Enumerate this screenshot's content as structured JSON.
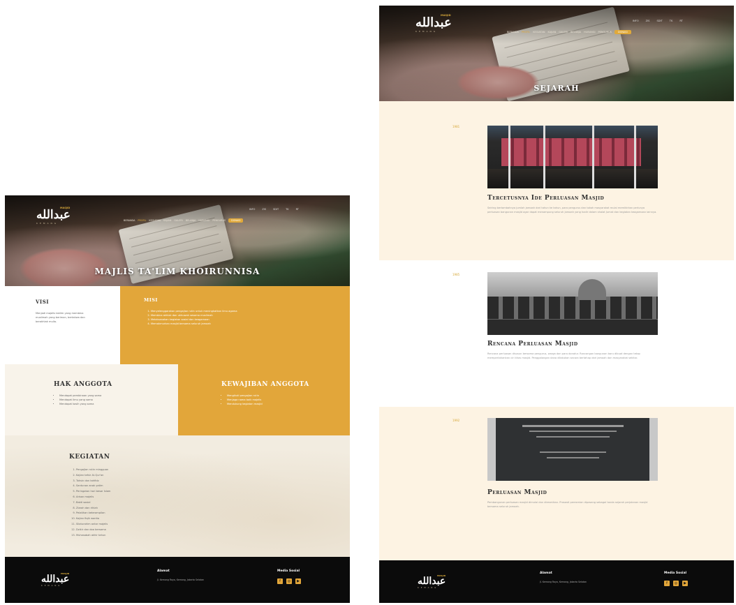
{
  "site": {
    "logo_arabic": "عبدالله",
    "logo_tag": "MASJID",
    "logo_sub": "KEMANG"
  },
  "top_nav": [
    "INFO",
    "ZIS",
    "SDIT",
    "TK",
    "RT"
  ],
  "main_nav": [
    "BERANDA",
    "PROFIL",
    "KEGIATAN",
    "KAJIAN",
    "GALERI",
    "BELANJA",
    "HUBUNGI",
    "PENGURUS",
    "DONASI"
  ],
  "left_page": {
    "hero_title": "MAJLIS TA'LIM KHOIRUNNISA",
    "visi": {
      "title": "VISI",
      "text": "Menjadi majelis taklim yang membina muslimah yang beriman, bertakwa dan berakhlak mulia."
    },
    "misi": {
      "title": "MISI",
      "items": [
        "Menyelenggarakan pengajian rutin untuk meningkatkan ilmu agama",
        "Membina akhlak dan ukhuwah sesama muslimah",
        "Melaksanakan kegiatan sosial dan keagamaan",
        "Memakmurkan masjid bersama seluruh jamaah"
      ]
    },
    "hak": {
      "title": "HAK ANGGOTA",
      "items": [
        "Mendapat pembinaan yang sama",
        "Mendapat ilmu yang sama",
        "Mendapat kasih yang sama"
      ]
    },
    "kewajiban": {
      "title": "KEWAJIBAN ANGGOTA",
      "items": [
        "Mengikuti pengajian rutin",
        "Menjaga nama baik majelis",
        "Mendukung kegiatan masjid"
      ]
    },
    "kegiatan": {
      "title": "KEGIATAN",
      "items": [
        "Pengajian rutin mingguan",
        "Kajian tafsir Al-Qur'an",
        "Tahsin dan tahfidz",
        "Santunan anak yatim",
        "Peringatan hari besar Islam",
        "Arisan majelis",
        "Bakti sosial",
        "Ziarah dan rihlah",
        "Pelatihan keterampilan",
        "Kajian fiqih wanita",
        "Silaturahim antar majelis",
        "Dzikir dan doa bersama",
        "Muhasabah akhir tahun"
      ]
    },
    "footer": {
      "addr_title": "Alamat",
      "address": "Jl. Kemang Raya, Kemang, Jakarta Selatan",
      "social_title": "Media Sosial"
    }
  },
  "right_page": {
    "hero_title": "SEJARAH",
    "sections": [
      {
        "year": "1981",
        "title": "Tercetusnya Ide Perluasan Masjid",
        "text": "Seiring bertambahnya jumlah jamaah dari tahun ke tahun, para pengurus dan tokoh masyarakat mulai memikirkan perlunya perluasan bangunan masjid agar dapat menampung seluruh jamaah yang hadir dalam shalat Jumat dan kegiatan keagamaan lainnya."
      },
      {
        "year": "1985",
        "title": "Rencana Perluasan Masjid",
        "text": "Rencana perluasan disusun bersama pengurus, warga dan para donatur. Rancangan bangunan baru dibuat dengan tetap mempertahankan ciri khas masjid. Penggalangan dana dilakukan secara bertahap dari jamaah dan masyarakat sekitar."
      },
      {
        "year": "1992",
        "title": "Perluasan Masjid",
        "text": "Pembangunan perluasan masjid dimulai dan diresmikan. Prasasti peresmian dipasang sebagai tanda sejarah perjalanan masjid bersama seluruh jamaah."
      }
    ],
    "footer": {
      "addr_title": "Alamat",
      "address": "Jl. Kemang Raya, Kemang, Jakarta Selatan",
      "social_title": "Media Sosial"
    }
  },
  "colors": {
    "gold": "#e2a63a",
    "cream": "#fdf3e3",
    "footer": "#0b0b0b"
  },
  "icons": [
    "facebook-icon",
    "instagram-icon",
    "youtube-icon"
  ]
}
